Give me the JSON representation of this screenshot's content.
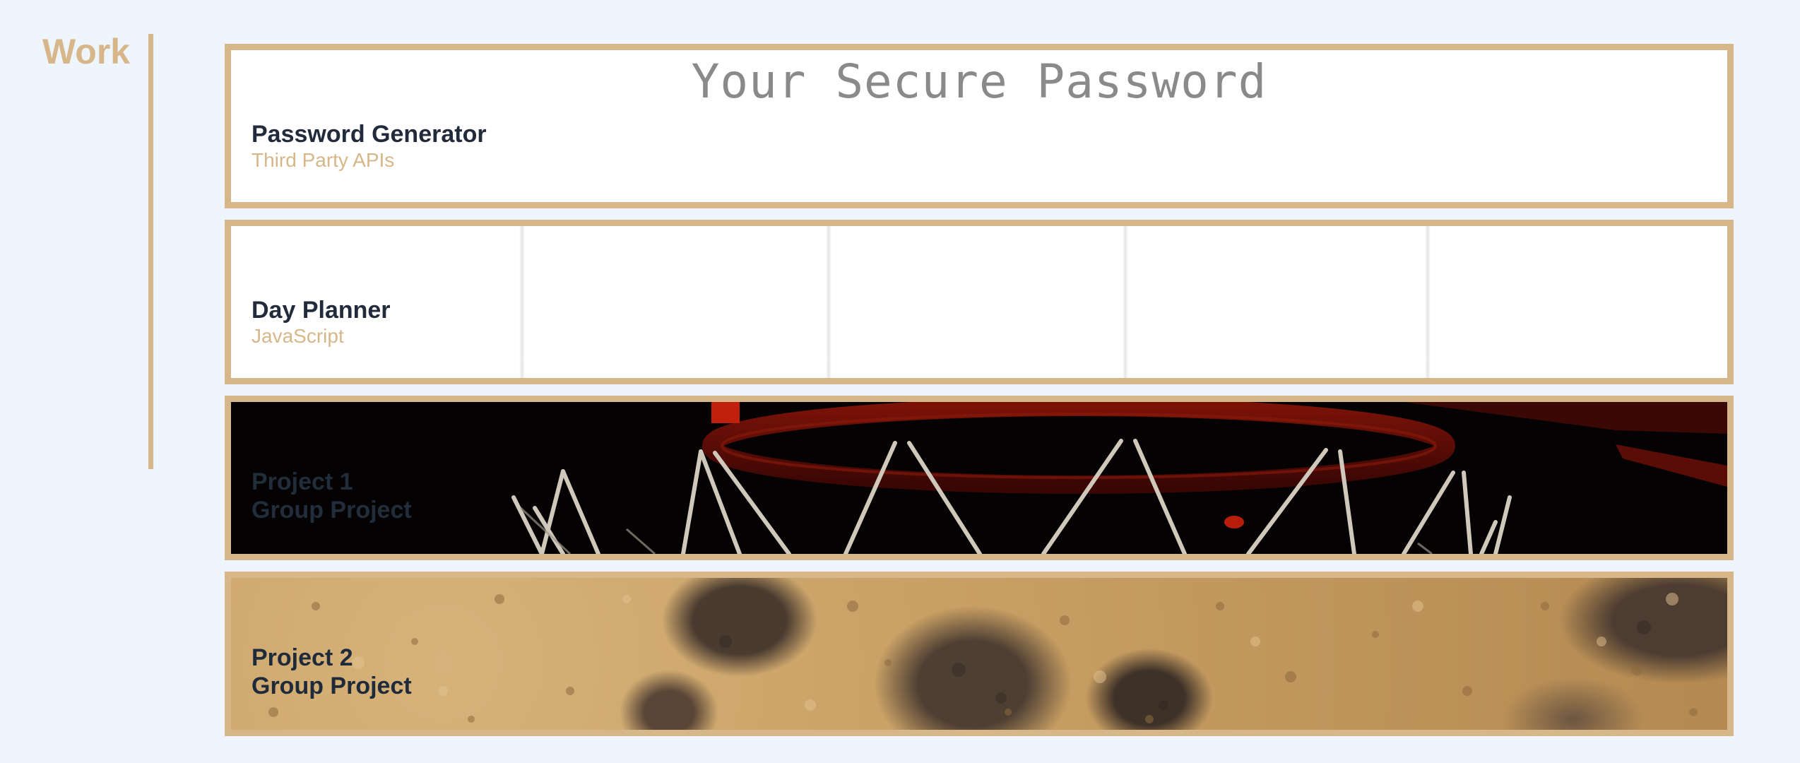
{
  "section": {
    "title": "Work"
  },
  "projects": [
    {
      "name": "Password Generator",
      "tech": "Third Party APIs",
      "preview_heading": "Your Secure Password"
    },
    {
      "name": "Day Planner",
      "tech": "JavaScript"
    },
    {
      "name": "Project 1",
      "tech": "Group Project"
    },
    {
      "name": "Project 2",
      "tech": "Group Project"
    }
  ],
  "colors": {
    "accent": "#d7b78a",
    "background": "#eef5fc",
    "title_text": "#212b3b"
  }
}
